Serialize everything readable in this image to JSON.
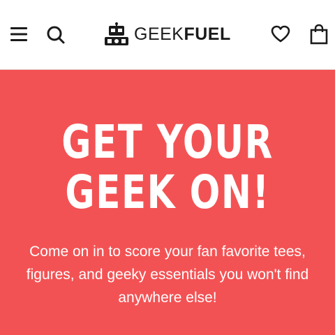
{
  "header": {
    "menu_icon": "hamburger-menu-icon",
    "search_icon": "search-icon",
    "logo": {
      "part1": "GEEK",
      "part2": "FUEL",
      "mascot_icon": "robot-mascot-icon"
    },
    "wishlist_icon": "heart-icon",
    "cart_icon": "shopping-bag-icon"
  },
  "hero": {
    "title_line1": "GET YOUR",
    "title_line2": "GEEK ON!",
    "body": "Come on in to score your fan favorite tees, figures, and geeky essentials you won't find anywhere else!"
  },
  "colors": {
    "hero_background": "#f35254",
    "text_light": "#ffffff",
    "text_dark": "#1a1a1a"
  }
}
